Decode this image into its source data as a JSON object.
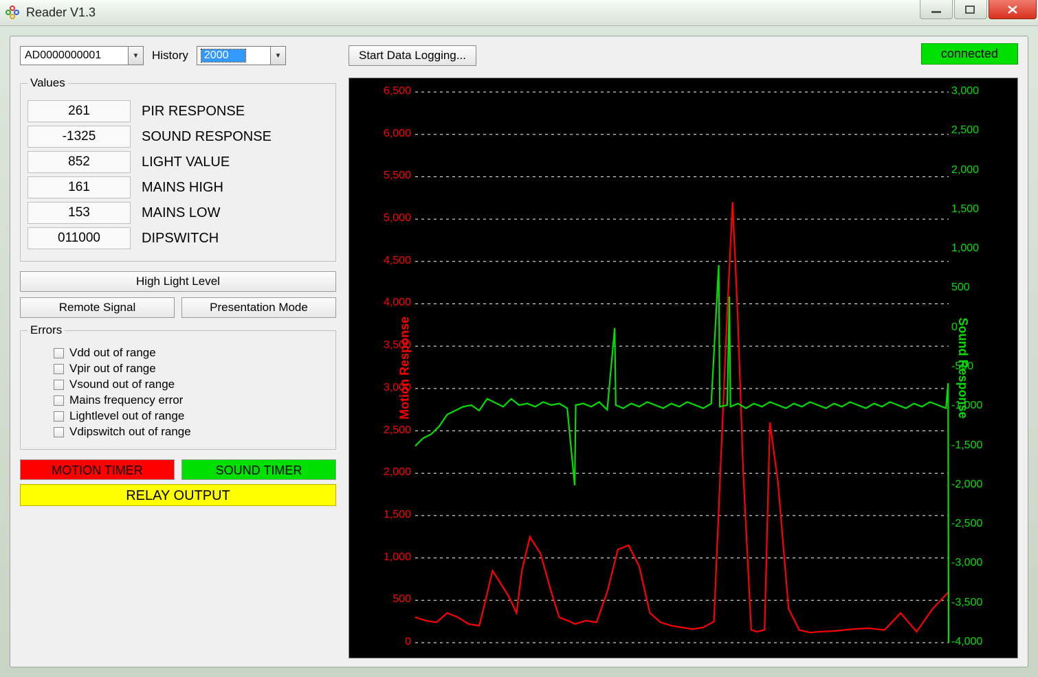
{
  "window": {
    "title": "Reader V1.3",
    "status": "connected"
  },
  "top": {
    "device": "AD0000000001",
    "history_label": "History",
    "history_value": "2000",
    "start_logging": "Start Data Logging..."
  },
  "values_group": {
    "legend": "Values",
    "rows": [
      {
        "val": "261",
        "label": "PIR RESPONSE"
      },
      {
        "val": "-1325",
        "label": "SOUND RESPONSE"
      },
      {
        "val": "852",
        "label": "LIGHT VALUE"
      },
      {
        "val": "161",
        "label": "MAINS HIGH"
      },
      {
        "val": "153",
        "label": "MAINS LOW"
      },
      {
        "val": "011000",
        "label": "DIPSWITCH"
      }
    ]
  },
  "buttons": {
    "high_light": "High Light Level",
    "remote": "Remote Signal",
    "presentation": "Presentation Mode"
  },
  "errors_group": {
    "legend": "Errors",
    "items": [
      "Vdd out of range",
      "Vpir out of range",
      "Vsound out of range",
      "Mains frequency error",
      "Lightlevel out of range",
      "Vdipswitch out of range"
    ]
  },
  "timers": {
    "motion": "MOTION TIMER",
    "sound": "SOUND TIMER",
    "relay": "RELAY OUTPUT"
  },
  "colors": {
    "motion": "#ff0000",
    "sound": "#00e000",
    "relay": "#ffff00",
    "status": "#00e000"
  },
  "chart_data": {
    "type": "line",
    "title": "",
    "left_axis": {
      "label": "Motion Response",
      "color": "#ff0000",
      "range": [
        0,
        6500
      ],
      "ticks": [
        0,
        500,
        1000,
        1500,
        2000,
        2500,
        3000,
        3500,
        4000,
        4500,
        5000,
        5500,
        6000,
        6500
      ]
    },
    "right_axis": {
      "label": "Sound Response",
      "color": "#00e000",
      "range": [
        -4000,
        3000
      ],
      "ticks": [
        -4000,
        -3500,
        -3000,
        -2500,
        -2000,
        -1500,
        -1000,
        -500,
        0,
        500,
        1000,
        1500,
        2000,
        2500,
        3000
      ]
    },
    "series": [
      {
        "name": "Motion Response",
        "axis": "left",
        "color": "#ff0000",
        "x": [
          0,
          40,
          80,
          120,
          160,
          200,
          240,
          260,
          290,
          320,
          350,
          380,
          400,
          430,
          470,
          510,
          540,
          580,
          600,
          640,
          680,
          720,
          760,
          800,
          840,
          880,
          920,
          960,
          1000,
          1040,
          1080,
          1120,
          1170,
          1190,
          1210,
          1230,
          1260,
          1280,
          1310,
          1330,
          1360,
          1400,
          1440,
          1480,
          1520,
          1580,
          1640,
          1700,
          1760,
          1820,
          1880,
          1940,
          2000
        ],
        "y": [
          300,
          260,
          240,
          350,
          300,
          220,
          200,
          450,
          850,
          700,
          550,
          350,
          850,
          1250,
          1050,
          600,
          300,
          250,
          220,
          260,
          240,
          600,
          1100,
          1150,
          900,
          350,
          240,
          200,
          180,
          160,
          180,
          250,
          3900,
          5200,
          3800,
          2000,
          150,
          130,
          150,
          2600,
          1900,
          400,
          150,
          120,
          130,
          140,
          160,
          170,
          150,
          350,
          130,
          400,
          600
        ]
      },
      {
        "name": "Sound Response",
        "axis": "right",
        "color": "#00e000",
        "x": [
          0,
          30,
          60,
          90,
          120,
          150,
          180,
          210,
          240,
          270,
          300,
          330,
          360,
          390,
          420,
          450,
          480,
          510,
          540,
          570,
          598,
          602,
          630,
          660,
          690,
          720,
          748,
          752,
          780,
          810,
          840,
          870,
          900,
          930,
          960,
          990,
          1020,
          1050,
          1080,
          1110,
          1138,
          1142,
          1170,
          1178,
          1182,
          1210,
          1240,
          1270,
          1300,
          1330,
          1360,
          1390,
          1420,
          1450,
          1480,
          1510,
          1540,
          1570,
          1600,
          1630,
          1660,
          1690,
          1720,
          1750,
          1780,
          1810,
          1840,
          1870,
          1900,
          1930,
          1960,
          1990,
          1998,
          2000
        ],
        "y": [
          -1500,
          -1400,
          -1350,
          -1250,
          -1100,
          -1050,
          -1000,
          -980,
          -1050,
          -900,
          -950,
          -1000,
          -900,
          -980,
          -960,
          -1000,
          -940,
          -980,
          -960,
          -1020,
          -2000,
          -980,
          -960,
          -1000,
          -940,
          -1040,
          0,
          -980,
          -1020,
          -960,
          -1000,
          -940,
          -980,
          -1020,
          -960,
          -1000,
          -940,
          -980,
          -1020,
          -960,
          800,
          -1000,
          -980,
          400,
          -1000,
          -960,
          -1020,
          -960,
          -1000,
          -940,
          -980,
          -1020,
          -960,
          -1000,
          -940,
          -980,
          -1020,
          -960,
          -1000,
          -940,
          -980,
          -1020,
          -960,
          -1000,
          -940,
          -980,
          -1020,
          -960,
          -1000,
          -940,
          -980,
          -1020,
          -700,
          -4000
        ]
      }
    ]
  }
}
